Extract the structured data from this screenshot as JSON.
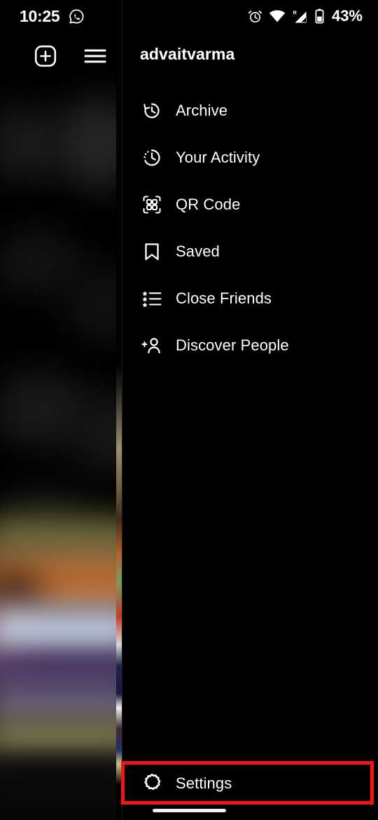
{
  "status_bar": {
    "time": "10:25",
    "battery_percent": "43%",
    "icons": [
      "whatsapp-notification-icon",
      "alarm-icon",
      "wifi-icon",
      "signal-roaming-icon",
      "battery-icon"
    ],
    "signal_roaming_label": "R"
  },
  "top_actions": {
    "add_post_label": "new-post",
    "menu_label": "menu"
  },
  "drawer": {
    "username": "advaitvarma",
    "items": [
      {
        "label": "Archive",
        "icon": "archive-clock-icon"
      },
      {
        "label": "Your Activity",
        "icon": "activity-clock-icon"
      },
      {
        "label": "QR Code",
        "icon": "qr-code-icon"
      },
      {
        "label": "Saved",
        "icon": "bookmark-icon"
      },
      {
        "label": "Close Friends",
        "icon": "close-friends-star-list-icon"
      },
      {
        "label": "Discover People",
        "icon": "person-add-icon"
      }
    ],
    "settings": {
      "label": "Settings",
      "icon": "settings-gear-icon"
    }
  },
  "annotation": {
    "highlight_color": "#f51313",
    "highlight_target": "Settings"
  },
  "theme": {
    "background": "#000000",
    "text": "#ffffff",
    "divider": "#1c1c1c"
  }
}
